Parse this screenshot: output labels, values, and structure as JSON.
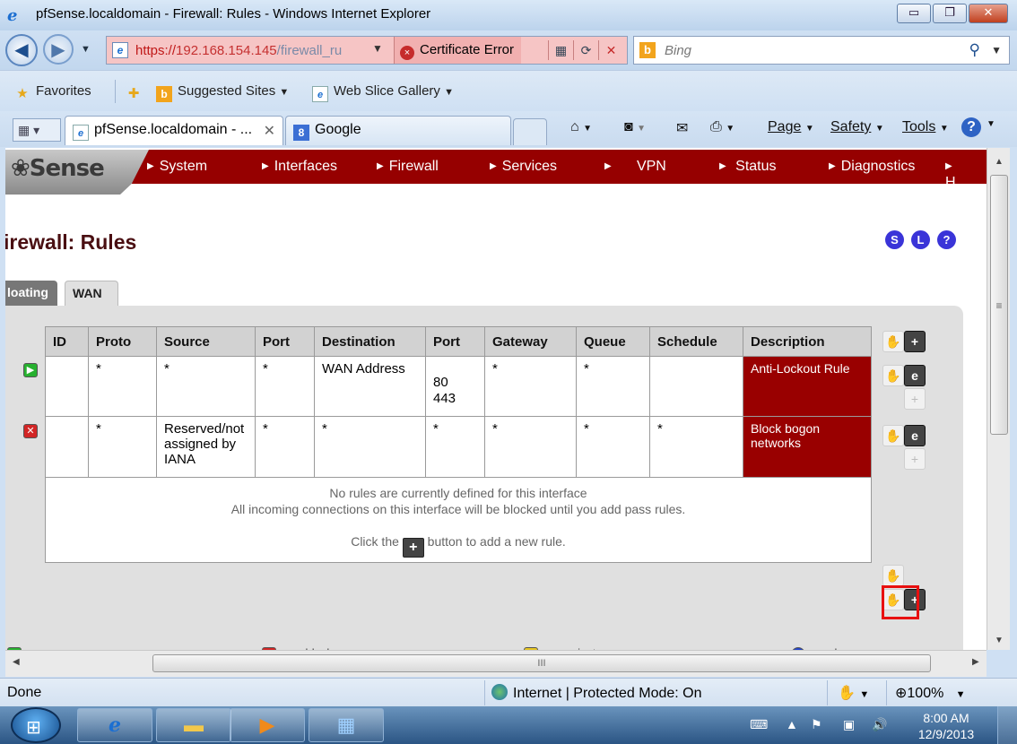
{
  "window": {
    "title": "pfSense.localdomain - Firewall: Rules - Windows Internet Explorer",
    "minimize_glyph": "▭",
    "maximize_glyph": "❐",
    "close_glyph": "✕"
  },
  "address_bar": {
    "url_scheme": "https://",
    "url_host": "192.168.154.145",
    "url_path": "/firewall_ru",
    "certificate_error": "Certificate Error"
  },
  "search": {
    "placeholder": "Bing"
  },
  "favorites_bar": {
    "favorites_label": "Favorites",
    "suggested_sites": "Suggested Sites",
    "web_slice_gallery": "Web Slice Gallery"
  },
  "tabs": [
    {
      "label": "pfSense.localdomain - ...",
      "active": true
    },
    {
      "label": "Google",
      "active": false
    }
  ],
  "command_bar": {
    "page": "Page",
    "safety": "Safety",
    "tools": "Tools"
  },
  "pfsense": {
    "logo": "Sense",
    "nav": [
      "System",
      "Interfaces",
      "Firewall",
      "Services",
      "VPN",
      "Status",
      "Diagnostics",
      "H"
    ],
    "page_title": "irewall: Rules",
    "header_buttons": [
      "S",
      "L",
      "?"
    ],
    "iface_tabs": [
      "loating",
      "WAN"
    ],
    "table": {
      "columns": [
        "ID",
        "Proto",
        "Source",
        "Port",
        "Destination",
        "Port",
        "Gateway",
        "Queue",
        "Schedule",
        "Description"
      ],
      "rows": [
        {
          "status": "pass",
          "id": "",
          "proto": "*",
          "source": "*",
          "src_port": "*",
          "destination": "WAN Address",
          "dst_port": "80\n443",
          "gateway": "*",
          "queue": "*",
          "schedule": "",
          "description": "Anti-Lockout Rule"
        },
        {
          "status": "block",
          "id": "",
          "proto": "*",
          "source": "Reserved/not assigned by IANA",
          "src_port": "*",
          "destination": "*",
          "dst_port": "*",
          "gateway": "*",
          "queue": "*",
          "schedule": "*",
          "description": "Block bogon networks"
        }
      ],
      "empty_line1": "No rules are currently defined for this interface",
      "empty_line2": "All incoming connections on this interface will be blocked until you add pass rules.",
      "click_prefix": "Click the",
      "click_suffix": "button to add a new rule."
    },
    "legend_peek": [
      "pass",
      "block",
      "reject",
      "log"
    ]
  },
  "scrollbar_grip": "III",
  "status_bar": {
    "left": "Done",
    "zone": "Internet | Protected Mode: On",
    "zoom": "100%"
  },
  "taskbar": {
    "time": "8:00 AM",
    "date": "12/9/2013"
  },
  "colors": {
    "pfsense_red": "#990000",
    "title_text": "#4a0f12",
    "highlight": "#e81010"
  }
}
